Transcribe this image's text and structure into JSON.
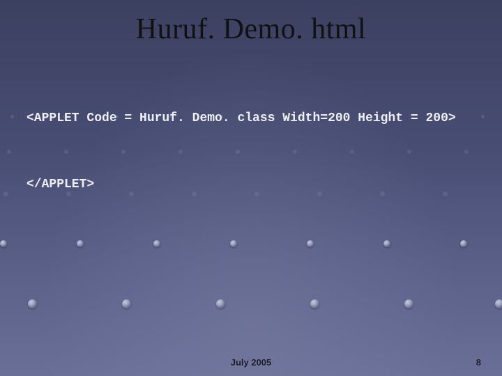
{
  "title": "Huruf. Demo. html",
  "code": {
    "line1": "<APPLET Code = Huruf. Demo. class Width=200 Height = 200>",
    "line2": "</APPLET>"
  },
  "footer": {
    "date": "July 2005",
    "page": "8"
  }
}
